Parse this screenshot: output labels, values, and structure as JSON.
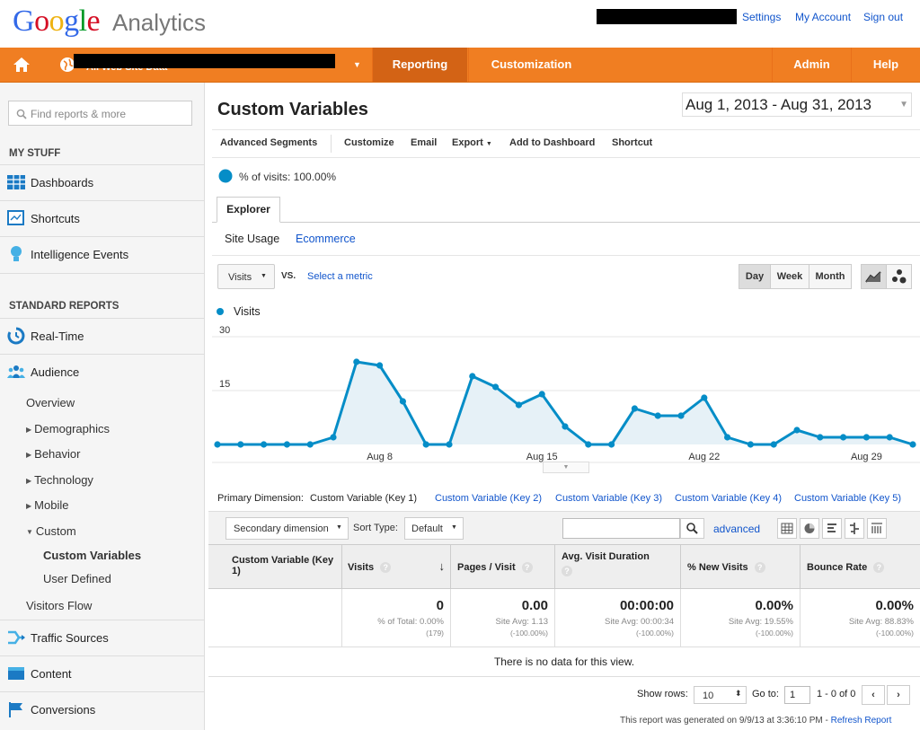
{
  "header": {
    "logo_letters": [
      "G",
      "o",
      "o",
      "g",
      "l",
      "e"
    ],
    "product": "Analytics",
    "links": [
      "Settings",
      "My Account",
      "Sign out"
    ]
  },
  "nav": {
    "account_label": "All Web Site Data",
    "items": [
      "Reporting",
      "Customization",
      "Admin",
      "Help"
    ]
  },
  "sidebar": {
    "search_placeholder": "Find reports & more",
    "my_stuff_heading": "MY STUFF",
    "my_stuff": [
      "Dashboards",
      "Shortcuts",
      "Intelligence Events"
    ],
    "standard_heading": "STANDARD REPORTS",
    "realtime": "Real-Time",
    "audience": "Audience",
    "audience_sub": [
      "Overview",
      "Demographics",
      "Behavior",
      "Technology",
      "Mobile",
      "Custom"
    ],
    "custom_sub": [
      "Custom Variables",
      "User Defined"
    ],
    "visitors_flow": "Visitors Flow",
    "bottom": [
      "Traffic Sources",
      "Content",
      "Conversions"
    ]
  },
  "main": {
    "title": "Custom Variables",
    "date_range": "Aug 1, 2013 - Aug 31, 2013",
    "toolbar": [
      "Advanced Segments",
      "Customize",
      "Email",
      "Export",
      "Add to Dashboard",
      "Shortcut"
    ],
    "segment": "% of visits: 100.00%",
    "tab": "Explorer",
    "subtabs": [
      "Site Usage",
      "Ecommerce"
    ],
    "metric_select": "Visits",
    "vs": "VS.",
    "select_metric": "Select a metric",
    "periods": [
      "Day",
      "Week",
      "Month"
    ],
    "legend": "Visits",
    "primary_dim_label": "Primary Dimension:",
    "primary_dim_active": "Custom Variable (Key 1)",
    "primary_dim_links": [
      "Custom Variable (Key 2)",
      "Custom Variable (Key 3)",
      "Custom Variable (Key 4)",
      "Custom Variable (Key 5)"
    ],
    "secondary_dim": "Secondary dimension",
    "sort_type_label": "Sort Type:",
    "sort_type": "Default",
    "advanced": "advanced"
  },
  "table": {
    "headers": [
      "Custom Variable (Key 1)",
      "Visits",
      "Pages / Visit",
      "Avg. Visit Duration",
      "% New Visits",
      "Bounce Rate"
    ],
    "totals": [
      {
        "value": "0",
        "sub1": "% of Total: 0.00%",
        "sub2": "(179)"
      },
      {
        "value": "0.00",
        "sub1": "Site Avg: 1.13",
        "sub2": "(-100.00%)"
      },
      {
        "value": "00:00:00",
        "sub1": "Site Avg: 00:00:34",
        "sub2": "(-100.00%)"
      },
      {
        "value": "0.00%",
        "sub1": "Site Avg: 19.55%",
        "sub2": "(-100.00%)"
      },
      {
        "value": "0.00%",
        "sub1": "Site Avg: 88.83%",
        "sub2": "(-100.00%)"
      }
    ],
    "empty_message": "There is no data for this view.",
    "show_rows_label": "Show rows:",
    "show_rows": "10",
    "goto_label": "Go to:",
    "goto": "1",
    "range": "1 - 0 of 0",
    "footer": "This report was generated on 9/9/13 at 3:36:10 PM - ",
    "refresh": "Refresh Report"
  },
  "colors": {
    "orange": "#f07e22",
    "series": "#058dc7",
    "fill": "#e6f1f7",
    "link": "#1155cc"
  },
  "chart_data": {
    "type": "area",
    "x": [
      "Aug 1",
      "Aug 2",
      "Aug 3",
      "Aug 4",
      "Aug 5",
      "Aug 6",
      "Aug 7",
      "Aug 8",
      "Aug 9",
      "Aug 10",
      "Aug 11",
      "Aug 12",
      "Aug 13",
      "Aug 14",
      "Aug 15",
      "Aug 16",
      "Aug 17",
      "Aug 18",
      "Aug 19",
      "Aug 20",
      "Aug 21",
      "Aug 22",
      "Aug 23",
      "Aug 24",
      "Aug 25",
      "Aug 26",
      "Aug 27",
      "Aug 28",
      "Aug 29",
      "Aug 30",
      "Aug 31"
    ],
    "series": [
      {
        "name": "Visits",
        "values": [
          0,
          0,
          0,
          0,
          0,
          2,
          23,
          22,
          12,
          0,
          0,
          19,
          16,
          11,
          14,
          5,
          0,
          0,
          10,
          8,
          8,
          13,
          2,
          0,
          0,
          4,
          2,
          2,
          2,
          2,
          0
        ]
      }
    ],
    "xticks": [
      "Aug 8",
      "Aug 15",
      "Aug 22",
      "Aug 29"
    ],
    "yticks": [
      30,
      15
    ],
    "ylim": [
      0,
      30
    ],
    "legend": "top-left"
  }
}
